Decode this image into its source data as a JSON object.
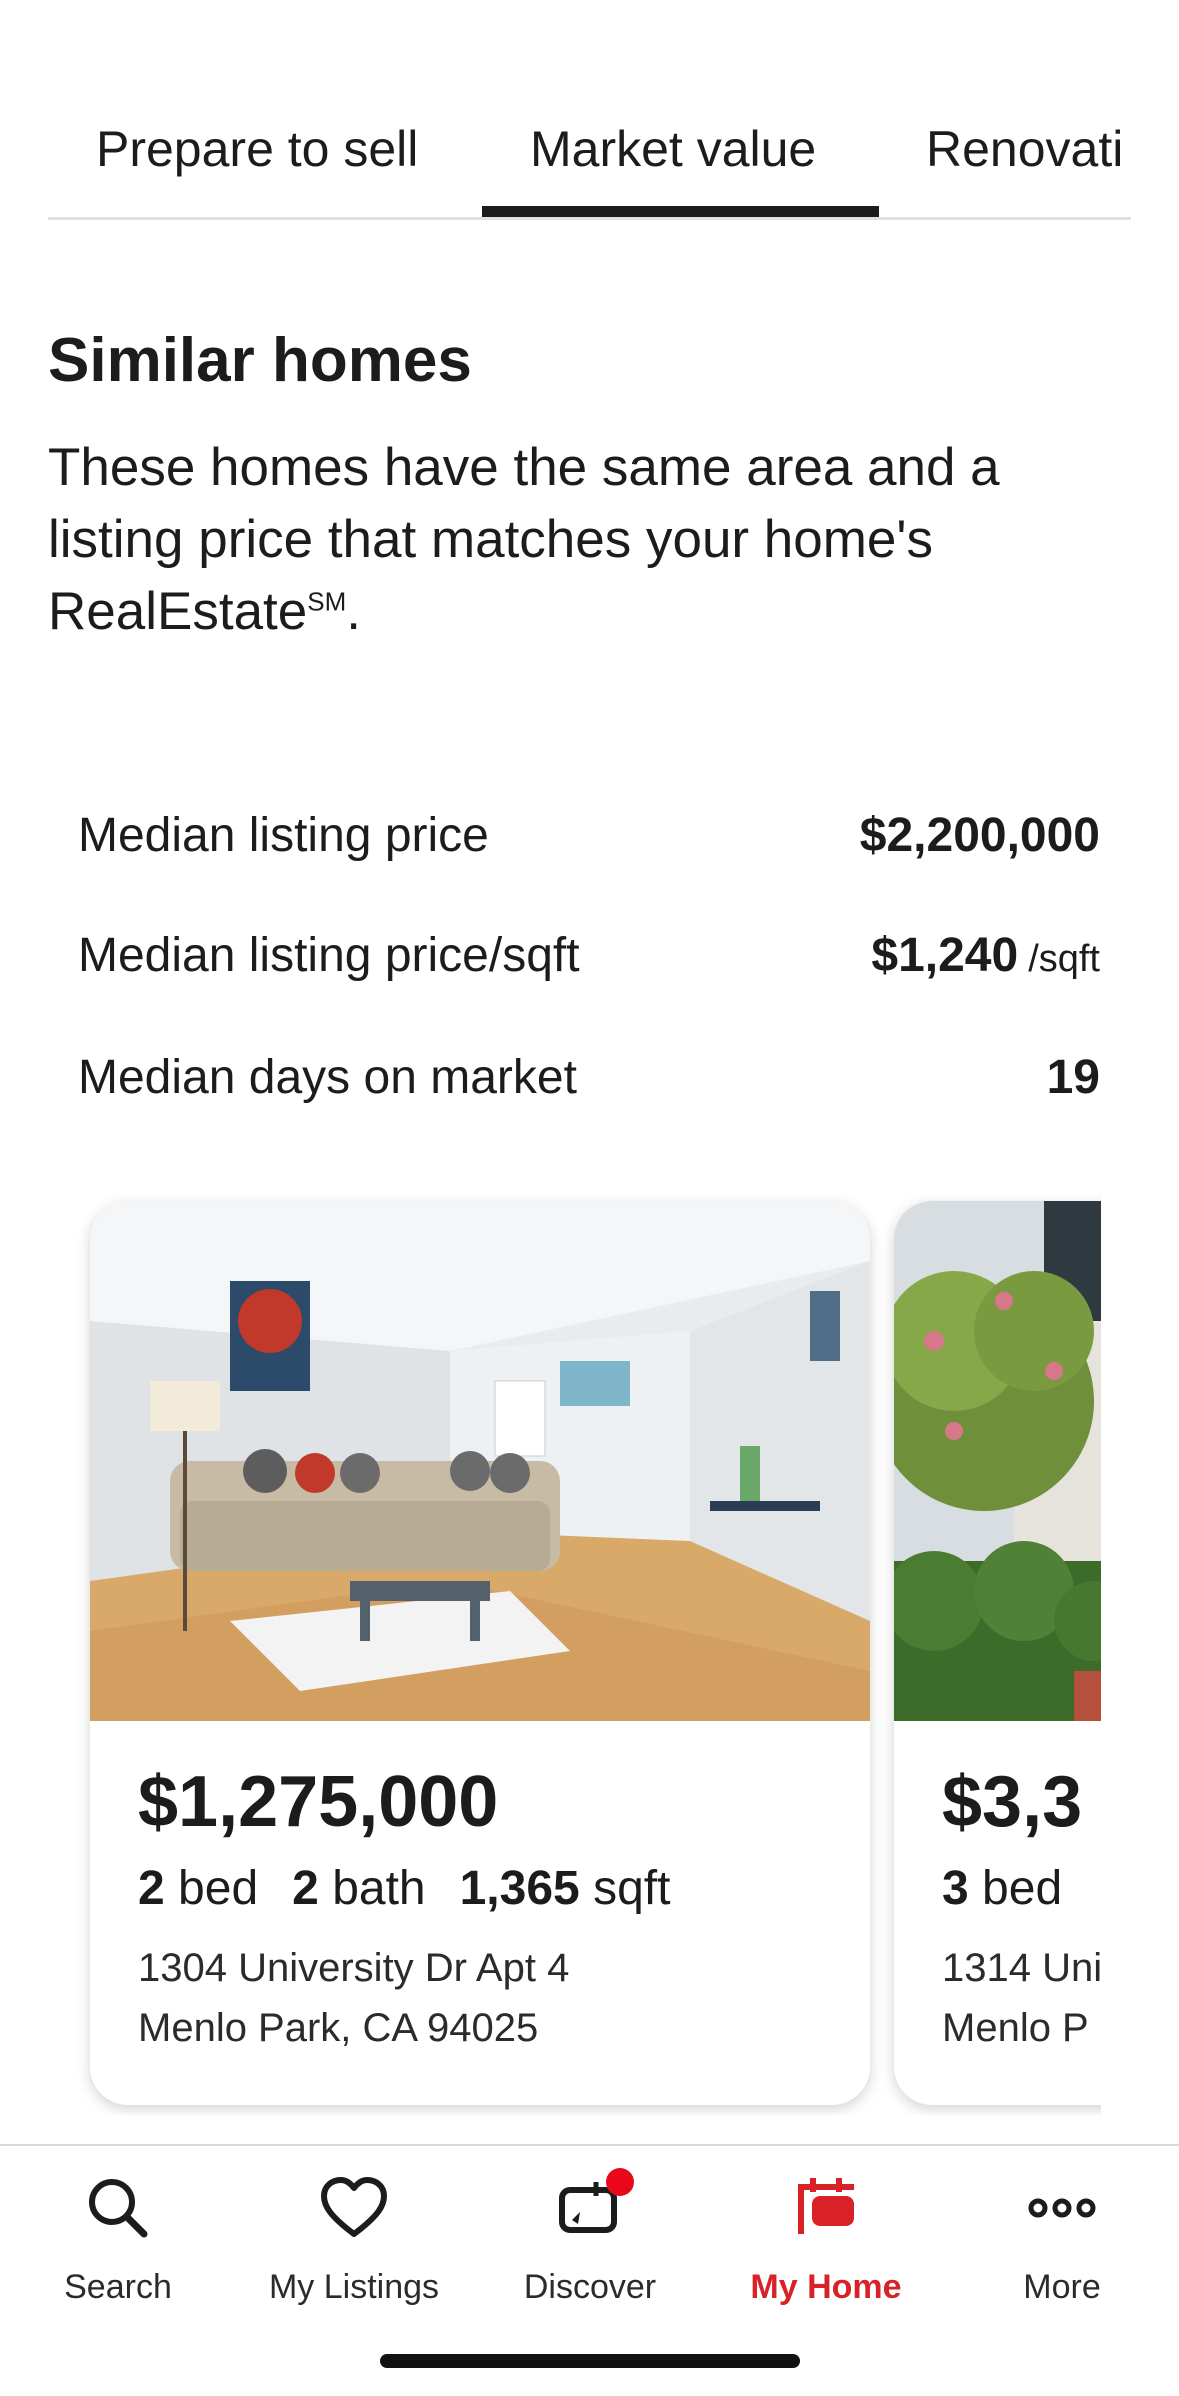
{
  "tabs": [
    {
      "label": "Prepare to sell",
      "active": false
    },
    {
      "label": "Market value",
      "active": true
    },
    {
      "label": "Renovati",
      "active": false
    }
  ],
  "section": {
    "title": "Similar homes",
    "description": "These homes have the same area and a listing price that matches your home's RealEstate",
    "description_mark": "SM",
    "description_end": "."
  },
  "stats": [
    {
      "label": "Median listing price",
      "value": "$2,200,000",
      "unit": ""
    },
    {
      "label": "Median listing price/sqft",
      "value": "$1,240",
      "unit": "/sqft"
    },
    {
      "label": "Median days on market",
      "value": "19",
      "unit": ""
    }
  ],
  "listings": [
    {
      "price": "$1,275,000",
      "beds": "2",
      "beds_label": "bed",
      "baths": "2",
      "baths_label": "bath",
      "sqft": "1,365",
      "sqft_label": "sqft",
      "address_line1": "1304 University Dr Apt 4",
      "address_line2": "Menlo Park, CA 94025"
    },
    {
      "price": "$3,3",
      "beds": "3",
      "beds_label": "bed",
      "address_line1": "1314 Uni",
      "address_line2": "Menlo P"
    }
  ],
  "bottom_nav": [
    {
      "label": "Search",
      "icon": "search-icon",
      "active": false
    },
    {
      "label": "My Listings",
      "icon": "heart-icon",
      "active": false
    },
    {
      "label": "Discover",
      "icon": "discover-icon",
      "active": false,
      "badge": true
    },
    {
      "label": "My Home",
      "icon": "home-icon",
      "active": true
    },
    {
      "label": "More",
      "icon": "more-icon",
      "active": false
    }
  ],
  "colors": {
    "accent": "#d92228",
    "badge": "#e8081a",
    "text": "#1c1c1c"
  }
}
